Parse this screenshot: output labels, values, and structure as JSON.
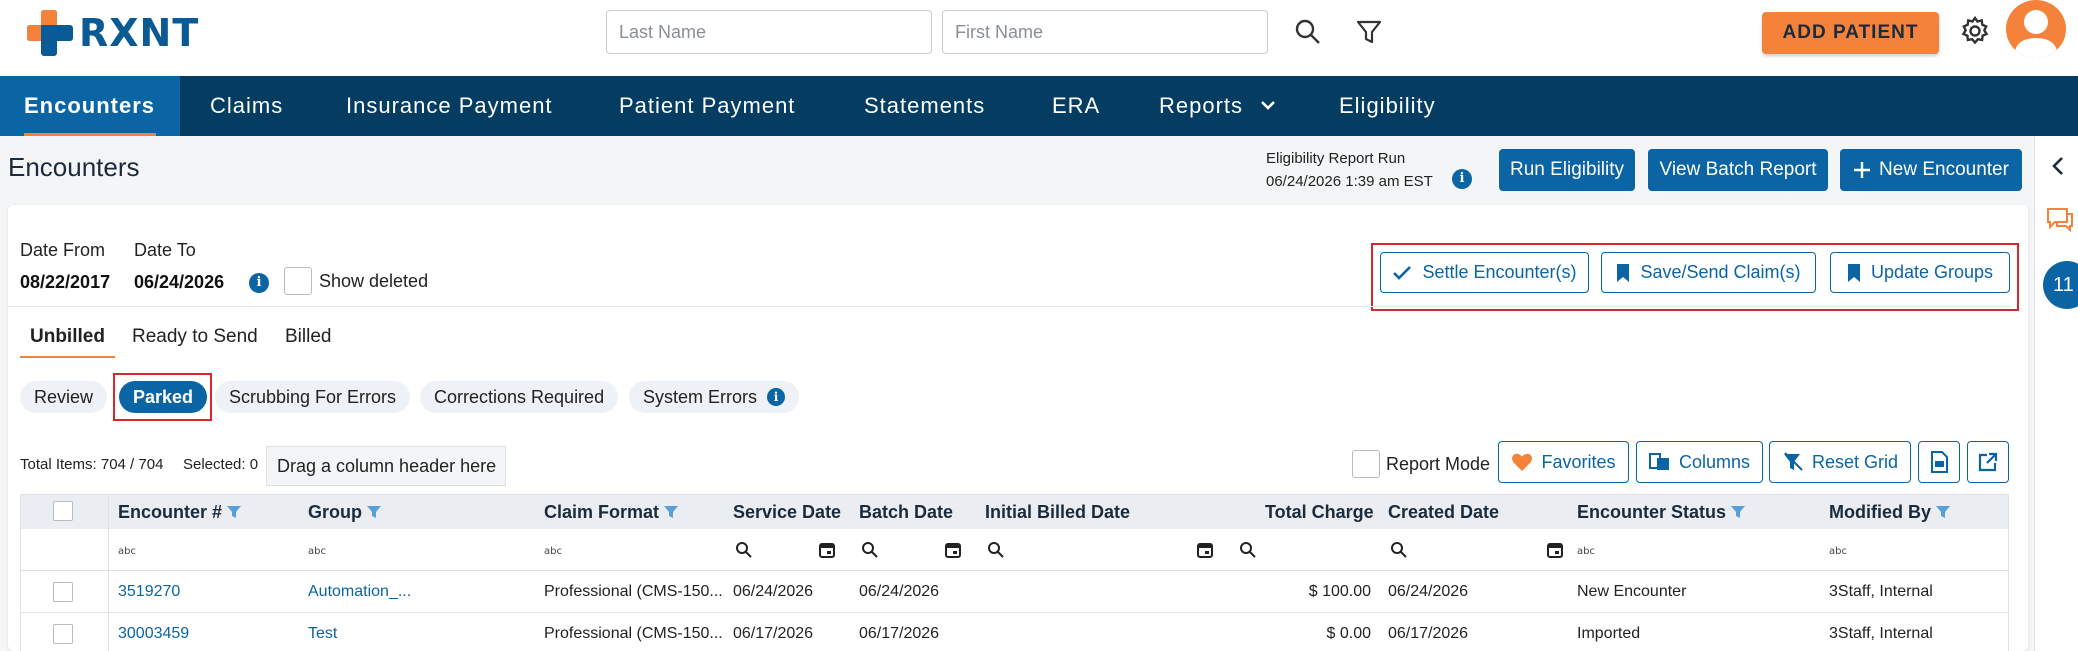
{
  "header": {
    "logo_text": "RXNT",
    "last_name_placeholder": "Last Name",
    "first_name_placeholder": "First Name",
    "add_patient_label": "ADD PATIENT"
  },
  "nav": {
    "items": [
      "Encounters",
      "Claims",
      "Insurance Payment",
      "Patient Payment",
      "Statements",
      "ERA",
      "Reports",
      "Eligibility"
    ]
  },
  "page": {
    "title": "Encounters",
    "eligibility_label": "Eligibility Report Run",
    "eligibility_date": "06/24/2026 1:39 am EST",
    "run_eligibility_label": "Run Eligibility",
    "view_batch_report_label": "View Batch Report",
    "new_encounter_label": "New Encounter"
  },
  "filters": {
    "date_from_label": "Date From",
    "date_from_value": "08/22/2017",
    "date_to_label": "Date To",
    "date_to_value": "06/24/2026",
    "show_deleted_label": "Show deleted"
  },
  "actions": {
    "settle_label": "Settle Encounter(s)",
    "save_send_label": "Save/Send Claim(s)",
    "update_groups_label": "Update Groups"
  },
  "tabs": [
    "Unbilled",
    "Ready to Send",
    "Billed"
  ],
  "pills": [
    "Review",
    "Parked",
    "Scrubbing For Errors",
    "Corrections Required",
    "System Errors"
  ],
  "toolbar": {
    "total_items": "Total Items: 704 / 704",
    "selected": "Selected: 0",
    "drag_hint": "Drag a column header here",
    "report_mode_label": "Report Mode",
    "favorites_label": "Favorites",
    "columns_label": "Columns",
    "reset_grid_label": "Reset Grid"
  },
  "grid": {
    "columns": [
      "Encounter #",
      "Group",
      "Claim Format",
      "Service Date",
      "Batch Date",
      "Initial Billed Date",
      "Total Charge",
      "Created Date",
      "Encounter Status",
      "Modified By"
    ],
    "rows": [
      {
        "encounter": "3519270",
        "group": "Automation_...",
        "claim_format": "Professional (CMS-150...",
        "service_date": "06/24/2026",
        "batch_date": "06/24/2026",
        "initial_billed": "",
        "total_charge": "$ 100.00",
        "created_date": "06/24/2026",
        "status": "New Encounter",
        "modified_by": "3Staff, Internal"
      },
      {
        "encounter": "30003459",
        "group": "Test",
        "claim_format": "Professional (CMS-150...",
        "service_date": "06/17/2026",
        "batch_date": "06/17/2026",
        "initial_billed": "",
        "total_charge": "$ 0.00",
        "created_date": "06/17/2026",
        "status": "Imported",
        "modified_by": "3Staff, Internal"
      }
    ]
  },
  "rail": {
    "badge_count": "11"
  },
  "colors": {
    "brand_blue": "#0b64a4",
    "nav_dark": "#053c61",
    "accent_orange": "#f4823a",
    "highlight_red": "#d9262c"
  }
}
